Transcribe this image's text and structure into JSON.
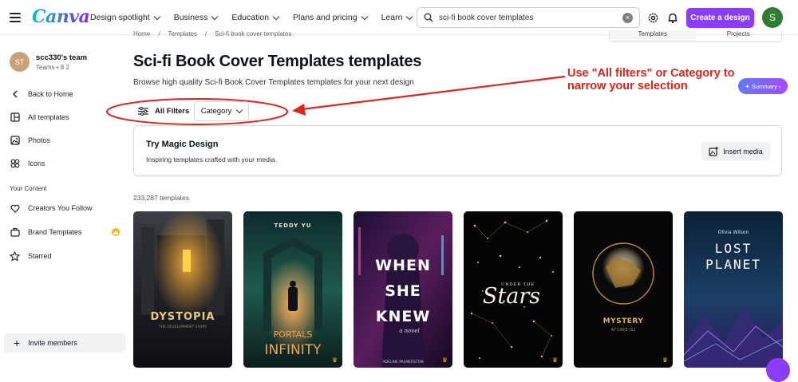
{
  "header": {
    "logo": "Canva",
    "nav": [
      "Design spotlight",
      "Business",
      "Education",
      "Plans and pricing",
      "Learn"
    ],
    "search_value": "sci-fi book cover templates",
    "create_label": "Create a design",
    "avatar_initial": "S"
  },
  "sidebar": {
    "team_initials": "ST",
    "team_name": "scc330's team",
    "team_meta": "Teams • 8 2",
    "items": [
      "Back to Home",
      "All templates",
      "Photos",
      "Icons"
    ],
    "section_label": "Your Content",
    "content_items": [
      "Creators You Follow",
      "Brand Templates",
      "Starred"
    ],
    "invite_label": "Invite members"
  },
  "main": {
    "breadcrumb": [
      "Home",
      "/",
      "Templates",
      "/",
      "Sci-fi book cover templates"
    ],
    "view_tabs": [
      "Templates",
      "Projects"
    ],
    "title": "Sci-fi Book Cover Templates templates",
    "subtitle": "Browse high quality Sci-fi Book Cover Templates templates for your next design",
    "annotation_line1": "Use \"All filters\" or Category to",
    "annotation_line2": "narrow your selection",
    "summary_label": "Summary",
    "filters_label": "All Filters",
    "category_label": "Category",
    "magic_title": "Try Magic Design",
    "magic_sub": "Inspiring templates crafted with your media.",
    "insert_label": "Insert media",
    "count": "233,287 templates"
  },
  "templates": [
    {
      "title": "DYSTOPIA",
      "subtitle": "THE DEVELOPMENT STORY",
      "premium": false
    },
    {
      "author": "TEDDY YU",
      "title_a": "PORTALS",
      "title_b": "INFINITY",
      "premium": true
    },
    {
      "title_a": "WHEN",
      "title_b": "SHE",
      "title_c": "KNEW",
      "tag": "a novel",
      "author": "ADELINE PALMERSTON",
      "premium": true
    },
    {
      "pre": "UNDER THE",
      "title": "Stars",
      "premium": true
    },
    {
      "title": "MYSTERY",
      "subtitle": "AT CAKE OLI",
      "premium": true
    },
    {
      "author": "Olivia Wilson",
      "title_a": "LOST",
      "title_b": "PLANET",
      "premium": false
    }
  ],
  "colors": {
    "brand_purple": "#8b3dff",
    "annotation_red": "#e0241c",
    "canva_teal": "#00c4cc"
  }
}
